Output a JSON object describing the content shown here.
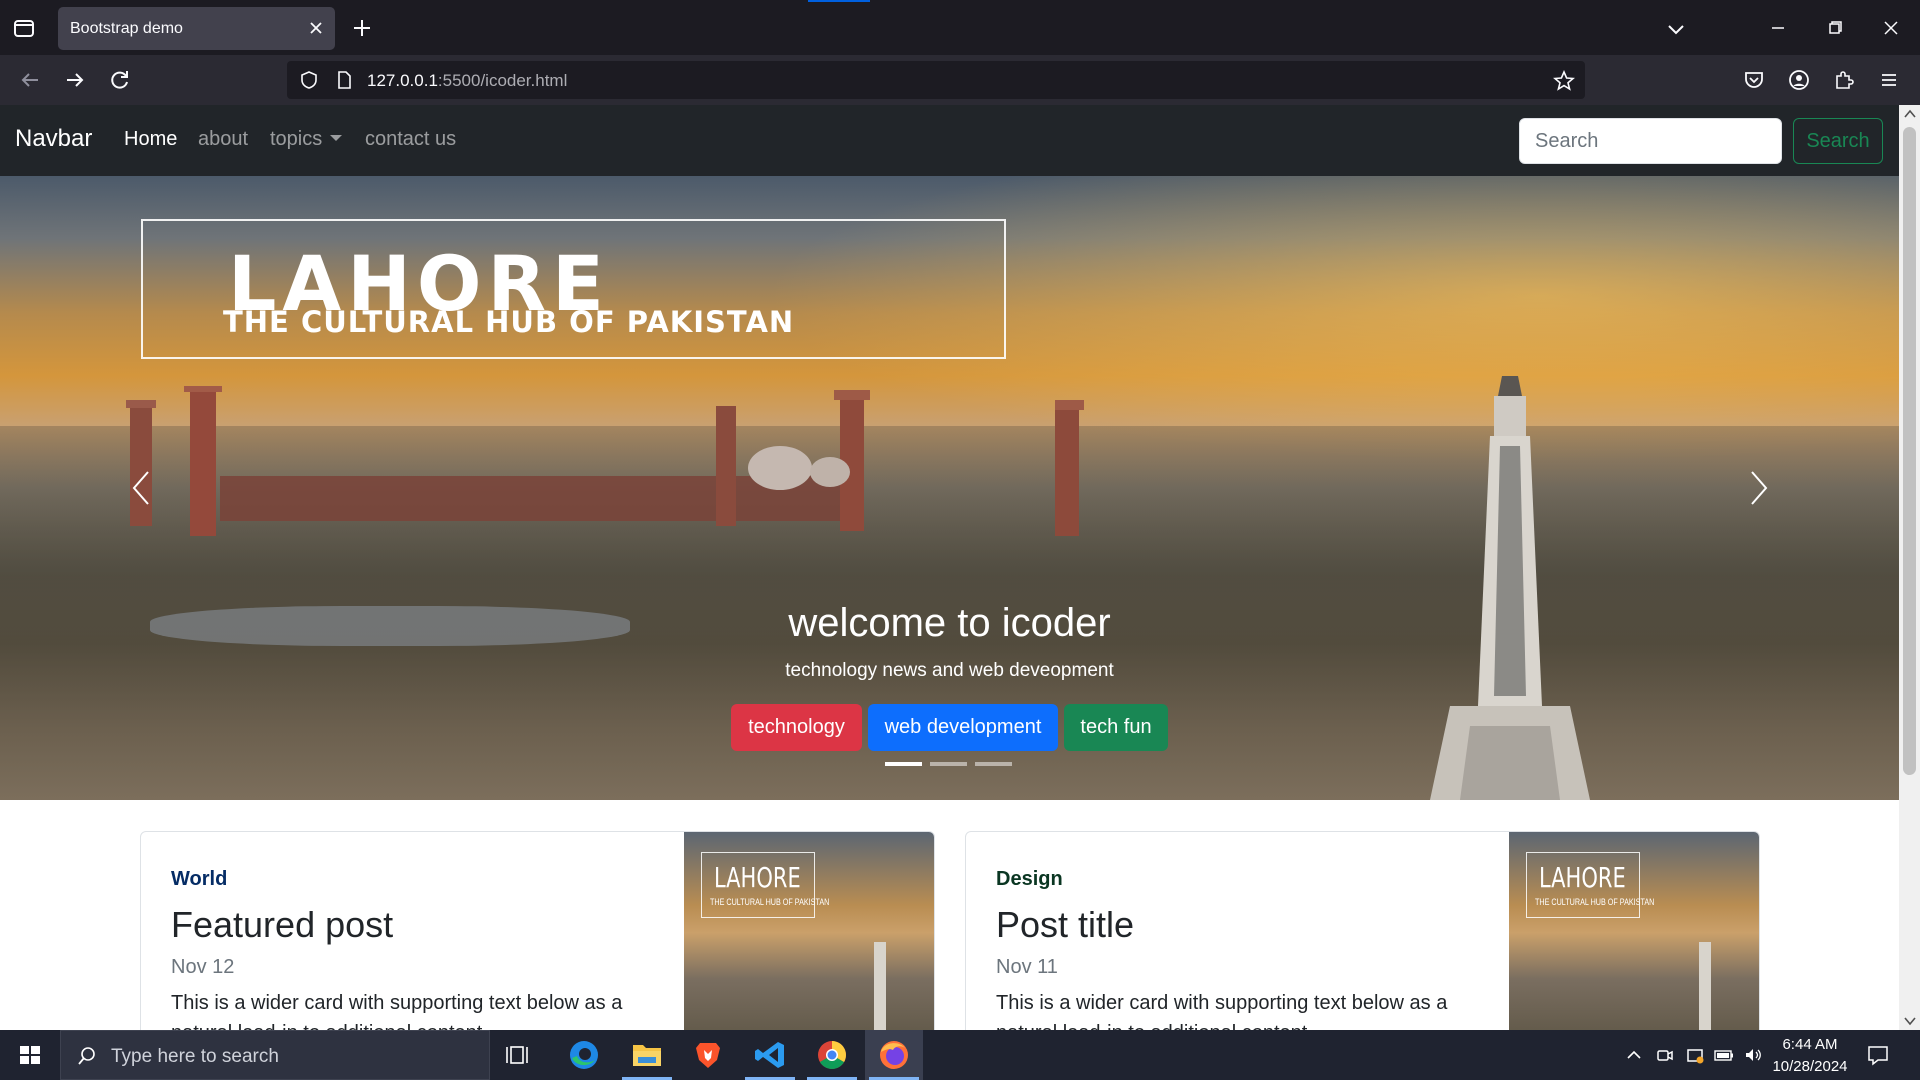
{
  "browser": {
    "tab_title": "Bootstrap demo",
    "url_host": "127.0.0.1",
    "url_path": ":5500/icoder.html"
  },
  "site": {
    "brand": "Navbar",
    "nav": [
      {
        "label": "Home",
        "active": true
      },
      {
        "label": "about",
        "active": false
      },
      {
        "label": "topics",
        "active": false
      },
      {
        "label": "contact us",
        "active": false
      }
    ],
    "search_placeholder": "Search",
    "search_button": "Search"
  },
  "carousel": {
    "banner_title": "LAHORE",
    "banner_subtitle": "THE CULTURAL HUB OF PAKISTAN",
    "caption_title": "welcome to icoder",
    "caption_text": "technology news and web deveopment",
    "buttons": [
      "technology",
      "web development",
      "tech fun"
    ],
    "slide_count": 3,
    "active_slide": 1
  },
  "cards": [
    {
      "category": "World",
      "title": "Featured post",
      "date": "Nov 12",
      "text": "This is a wider card with supporting text below as a natural lead-in to additional content.",
      "thumb_title": "LAHORE",
      "thumb_sub": "THE CULTURAL HUB OF PAKISTAN"
    },
    {
      "category": "Design",
      "title": "Post title",
      "date": "Nov 11",
      "text": "This is a wider card with supporting text below as a natural lead-in to additional content.",
      "thumb_title": "LAHORE",
      "thumb_sub": "THE CULTURAL HUB OF PAKISTAN"
    }
  ],
  "taskbar": {
    "search_placeholder": "Type here to search",
    "apps": [
      "task-view",
      "edge",
      "file-explorer",
      "brave",
      "vscode",
      "chrome",
      "firefox"
    ],
    "time": "6:44 AM",
    "date": "10/28/2024"
  },
  "colors": {
    "danger": "#dc3545",
    "primary": "#0d6efd",
    "success": "#198754",
    "navbar_bg": "#212529"
  }
}
